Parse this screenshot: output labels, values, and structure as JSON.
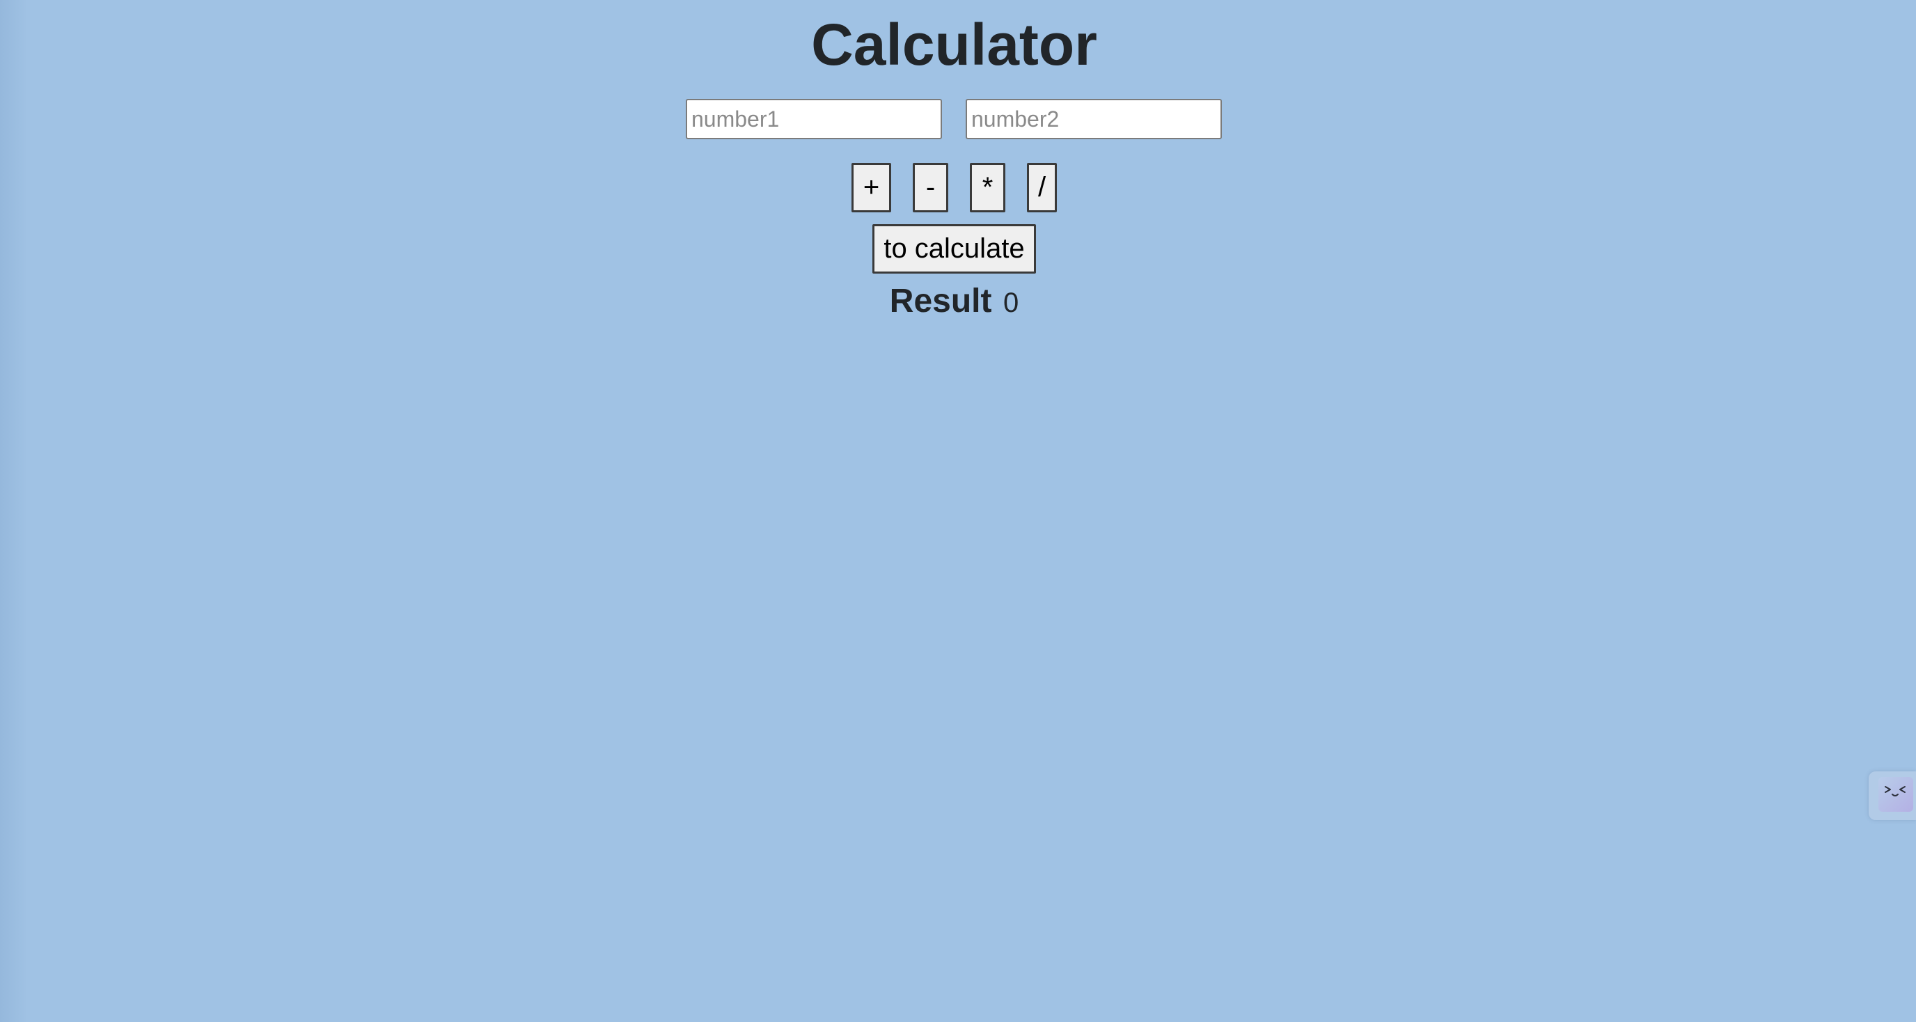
{
  "page": {
    "title": "Calculator"
  },
  "inputs": {
    "number1_placeholder": "number1",
    "number1_value": "",
    "number2_placeholder": "number2",
    "number2_value": ""
  },
  "operators": {
    "plus": "+",
    "minus": "-",
    "multiply": "*",
    "divide": "/"
  },
  "actions": {
    "calculate_label": "to calculate"
  },
  "result": {
    "label": "Result",
    "value": "0"
  },
  "widget": {
    "icon": "face-emoticon-icon"
  },
  "colors": {
    "background": "#a0c2e4",
    "button_background": "#efefef",
    "text": "#212529"
  }
}
